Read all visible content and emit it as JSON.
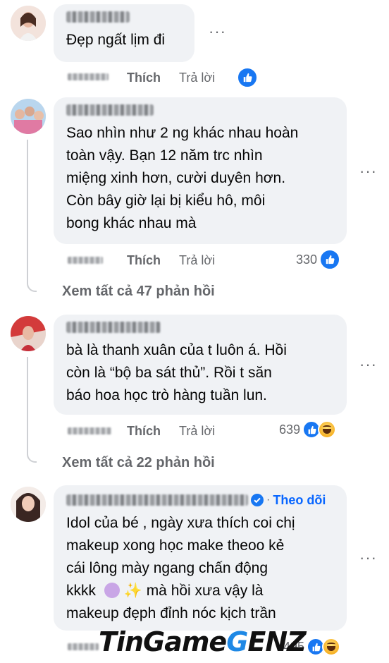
{
  "colors": {
    "bubble": "#f0f2f5",
    "meta": "#65676b",
    "like_blue": "#1877f2",
    "follow": "#0866ff"
  },
  "comments": [
    {
      "text": "Đẹp ngất lịm đi",
      "like_label": "Thích",
      "reply_label": "Trả lời",
      "reaction_icons": [
        "like-icon"
      ]
    },
    {
      "text": "Sao nhìn như 2 ng khác nhau hoàn toàn vậy. Bạn 12 năm trc nhìn miệng xinh hơn, cười duyên hơn. Còn bây giờ lại bị kiểu hô, môi bong khác nhau mà",
      "lines": [
        "Sao nhìn như 2 ng khác nhau hoàn",
        "toàn vậy. Bạn 12 năm trc nhìn",
        "miệng xinh hơn, cười duyên hơn.",
        "Còn bây giờ lại bị kiểu hô, môi",
        "bong khác nhau mà"
      ],
      "like_label": "Thích",
      "reply_label": "Trả lời",
      "reaction_count": "330",
      "reaction_icons": [
        "like-icon"
      ],
      "view_replies": "Xem tất cả 47 phản hồi"
    },
    {
      "lines": [
        "bà là thanh xuân của t luôn á. Hồi",
        "còn là “bộ ba sát thủ”. Rồi t săn",
        "báo hoa học trò hàng tuần lun."
      ],
      "like_label": "Thích",
      "reply_label": "Trả lời",
      "reaction_count": "639",
      "reaction_icons": [
        "like-icon",
        "haha-icon"
      ],
      "view_replies": "Xem tất cả 22 phản hồi"
    },
    {
      "follow_label": "Theo dõi",
      "lines": [
        "Idol của bé , ngày xưa thích coi chị",
        "makeup xong học make theoo kẻ",
        "cái lông mày ngang chấn động",
        "kkkk",
        "mà hồi xưa vậy là",
        "makeup đẹph đỉnh nóc kịch trần"
      ],
      "emoji": "✨",
      "reaction_count": "495",
      "reaction_icons": [
        "like-icon",
        "haha-icon"
      ]
    }
  ],
  "watermark": {
    "part1": "TinGame",
    "part2": "G",
    "part3": "ENZ"
  }
}
